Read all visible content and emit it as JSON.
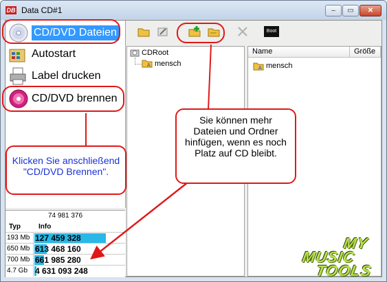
{
  "window": {
    "title": "Data CD#1",
    "app_icon": "DB",
    "controls": {
      "minimize": "–",
      "maximize": "▭",
      "close": "✕"
    }
  },
  "nav": {
    "items": [
      {
        "label": "CD/DVD Dateien",
        "icon": "cd-icon"
      },
      {
        "label": "Autostart",
        "icon": "autostart-icon"
      },
      {
        "label": "Label drucken",
        "icon": "printer-icon"
      },
      {
        "label": "CD/DVD brennen",
        "icon": "burn-disc-icon"
      }
    ]
  },
  "stats": {
    "total": "74 981 376",
    "header_typ": "Typ",
    "header_info": "Info",
    "rows": [
      {
        "typ": "193 Mb",
        "value": "127 459 328",
        "fill": 0.8
      },
      {
        "typ": "650 Mb",
        "value": "613 468 160",
        "fill": 0.14
      },
      {
        "typ": "700 Mb",
        "value": "661 985 280",
        "fill": 0.11
      },
      {
        "typ": "4.7 Gb",
        "value": "4 631 093 248",
        "fill": 0.02
      }
    ]
  },
  "toolbar": {
    "boot_label": "Boot"
  },
  "tree": {
    "root": "CDRoot",
    "child": "mensch"
  },
  "list": {
    "col_name": "Name",
    "col_size": "Größe",
    "items": [
      "mensch"
    ]
  },
  "callouts": {
    "left": "Klicken Sie anschließend \"CD/DVD Brennen\".",
    "right": "Sie können mehr Dateien und Ordner hinfügen, wenn es noch Platz auf CD bleibt."
  },
  "brand": {
    "line1": "MY",
    "line2": "MUSIC",
    "line3": "TOOLS"
  },
  "colors": {
    "accent": "#e01818",
    "selection": "#3399ff",
    "bar": "#2ab8e8"
  }
}
